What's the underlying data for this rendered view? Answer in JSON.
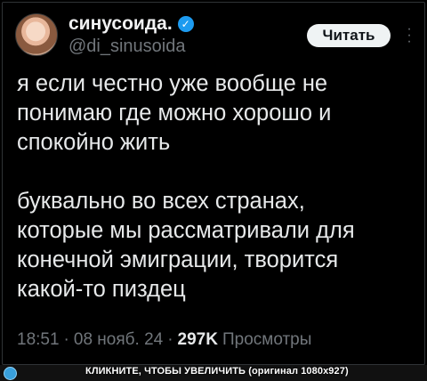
{
  "post": {
    "author": {
      "display_name": "синусоида.",
      "handle": "@di_sinusoida",
      "verified_icon": "verified-badge-icon",
      "verified_color": "#1d9bf0"
    },
    "follow_label": "Читать",
    "more_icon": "more-dots-icon",
    "text": "я если честно уже вообще не\nпонимаю где можно хорошо и\nспокойно жить\n\nбуквально во всех странах,\nкоторые мы рассматривали для\nконечной эмиграции, творится\nкакой-то пиздец",
    "time": "18:51",
    "separator": "·",
    "date": "08 нояб. 24",
    "views_count": "297K",
    "views_label": "Просмотры"
  },
  "footer": {
    "zoom_icon": "zoom-icon",
    "caption": "КЛИКНИТЕ, ЧТОБЫ УВЕЛИЧИТЬ (оригинал 1080x927)"
  }
}
